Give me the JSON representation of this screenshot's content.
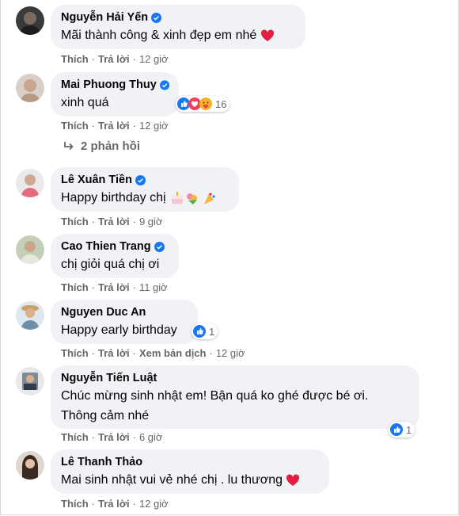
{
  "action_labels": {
    "like": "Thích",
    "reply": "Trả lời",
    "translate": "Xem bản dịch"
  },
  "comments": [
    {
      "name": "Nguyễn Hải Yến",
      "text": "Mãi thành công & xinh đẹp em nhé",
      "time": "12 giờ",
      "verified": true
    },
    {
      "name": "Mai Phuong Thuy",
      "text": "xinh quá",
      "time": "12 giờ",
      "verified": true,
      "reaction_count": "16"
    },
    {
      "name": "Lê Xuân Tiền",
      "text": "Happy birthday chị",
      "time": "9 giờ",
      "verified": true
    },
    {
      "name": "Cao Thien Trang",
      "text": "chị giỏi quá chị ơi",
      "time": "11 giờ",
      "verified": true
    },
    {
      "name": "Nguyen Duc An",
      "text": "Happy early birthday",
      "time": "12 giờ",
      "verified": false,
      "reaction_count": "1"
    },
    {
      "name": "Nguyễn Tiến Luật",
      "text_line1": "Chúc mừng sinh nhật em! Bận quá ko ghé được bé ơi.",
      "text_line2": "Thông cảm nhé",
      "time": "6 giờ",
      "verified": false,
      "reaction_count": "1"
    },
    {
      "name": "Lê Thanh Thảo",
      "text": "Mai sinh nhật vui vẻ nhé chị . lu thương",
      "time": "12 giờ",
      "verified": false
    }
  ],
  "replies_link": "2 phản hồi",
  "colors": {
    "verified": "#1877f2",
    "bubble": "#f0f2f5",
    "meta": "#65676b",
    "heart": "#e41e3f"
  }
}
